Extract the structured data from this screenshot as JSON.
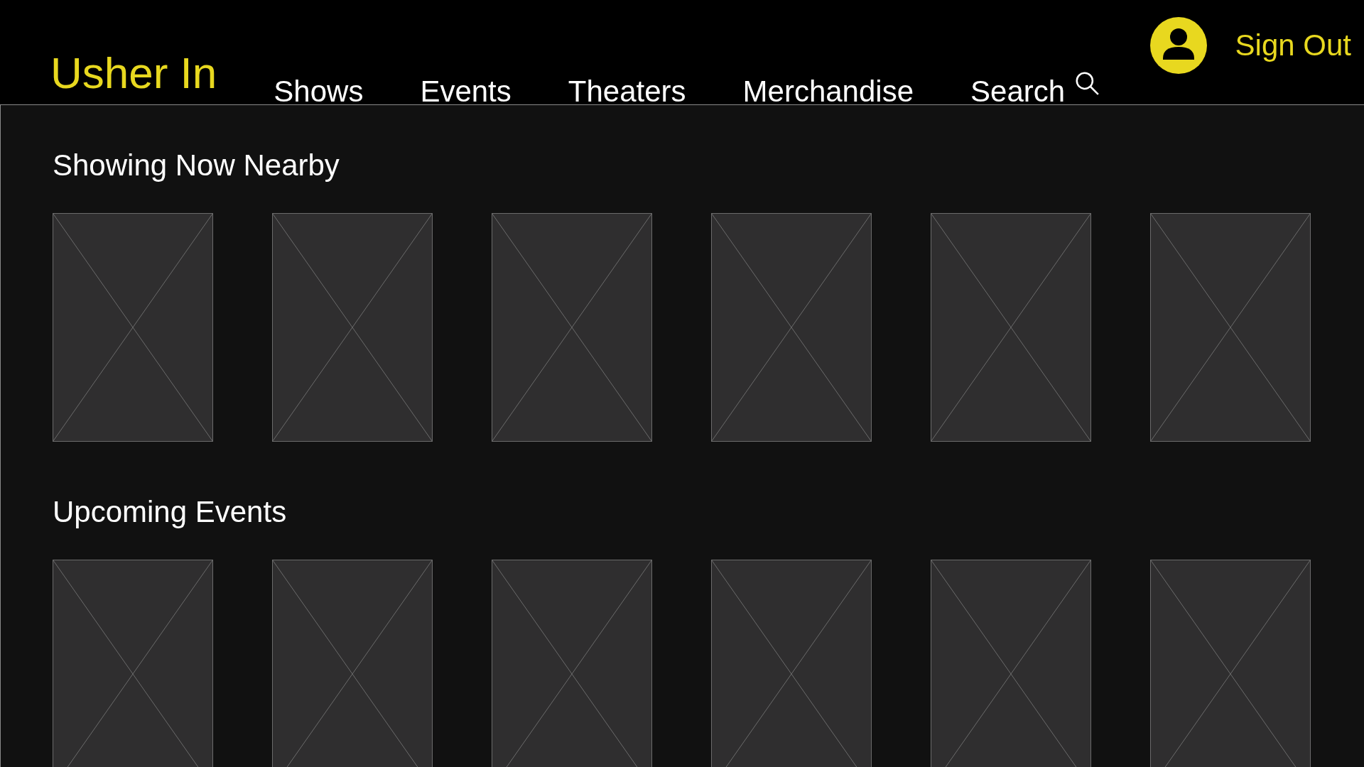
{
  "header": {
    "logo": "Usher In",
    "nav": [
      {
        "label": "Shows",
        "kind": "link"
      },
      {
        "label": "Events",
        "kind": "link"
      },
      {
        "label": "Theaters",
        "kind": "link"
      },
      {
        "label": "Merchandise",
        "kind": "link"
      },
      {
        "label": "Search",
        "kind": "search"
      }
    ],
    "sign_out": "Sign Out"
  },
  "sections": [
    {
      "title": "Showing Now Nearby",
      "cards": [
        {
          "kind": "image"
        },
        {
          "kind": "image"
        },
        {
          "kind": "image"
        },
        {
          "kind": "image"
        },
        {
          "kind": "image"
        },
        {
          "kind": "image"
        }
      ]
    },
    {
      "title": "Upcoming Events",
      "cards": [
        {
          "kind": "image"
        },
        {
          "kind": "image"
        },
        {
          "kind": "image"
        },
        {
          "kind": "image"
        },
        {
          "kind": "image"
        },
        {
          "kind": "image"
        }
      ]
    }
  ]
}
